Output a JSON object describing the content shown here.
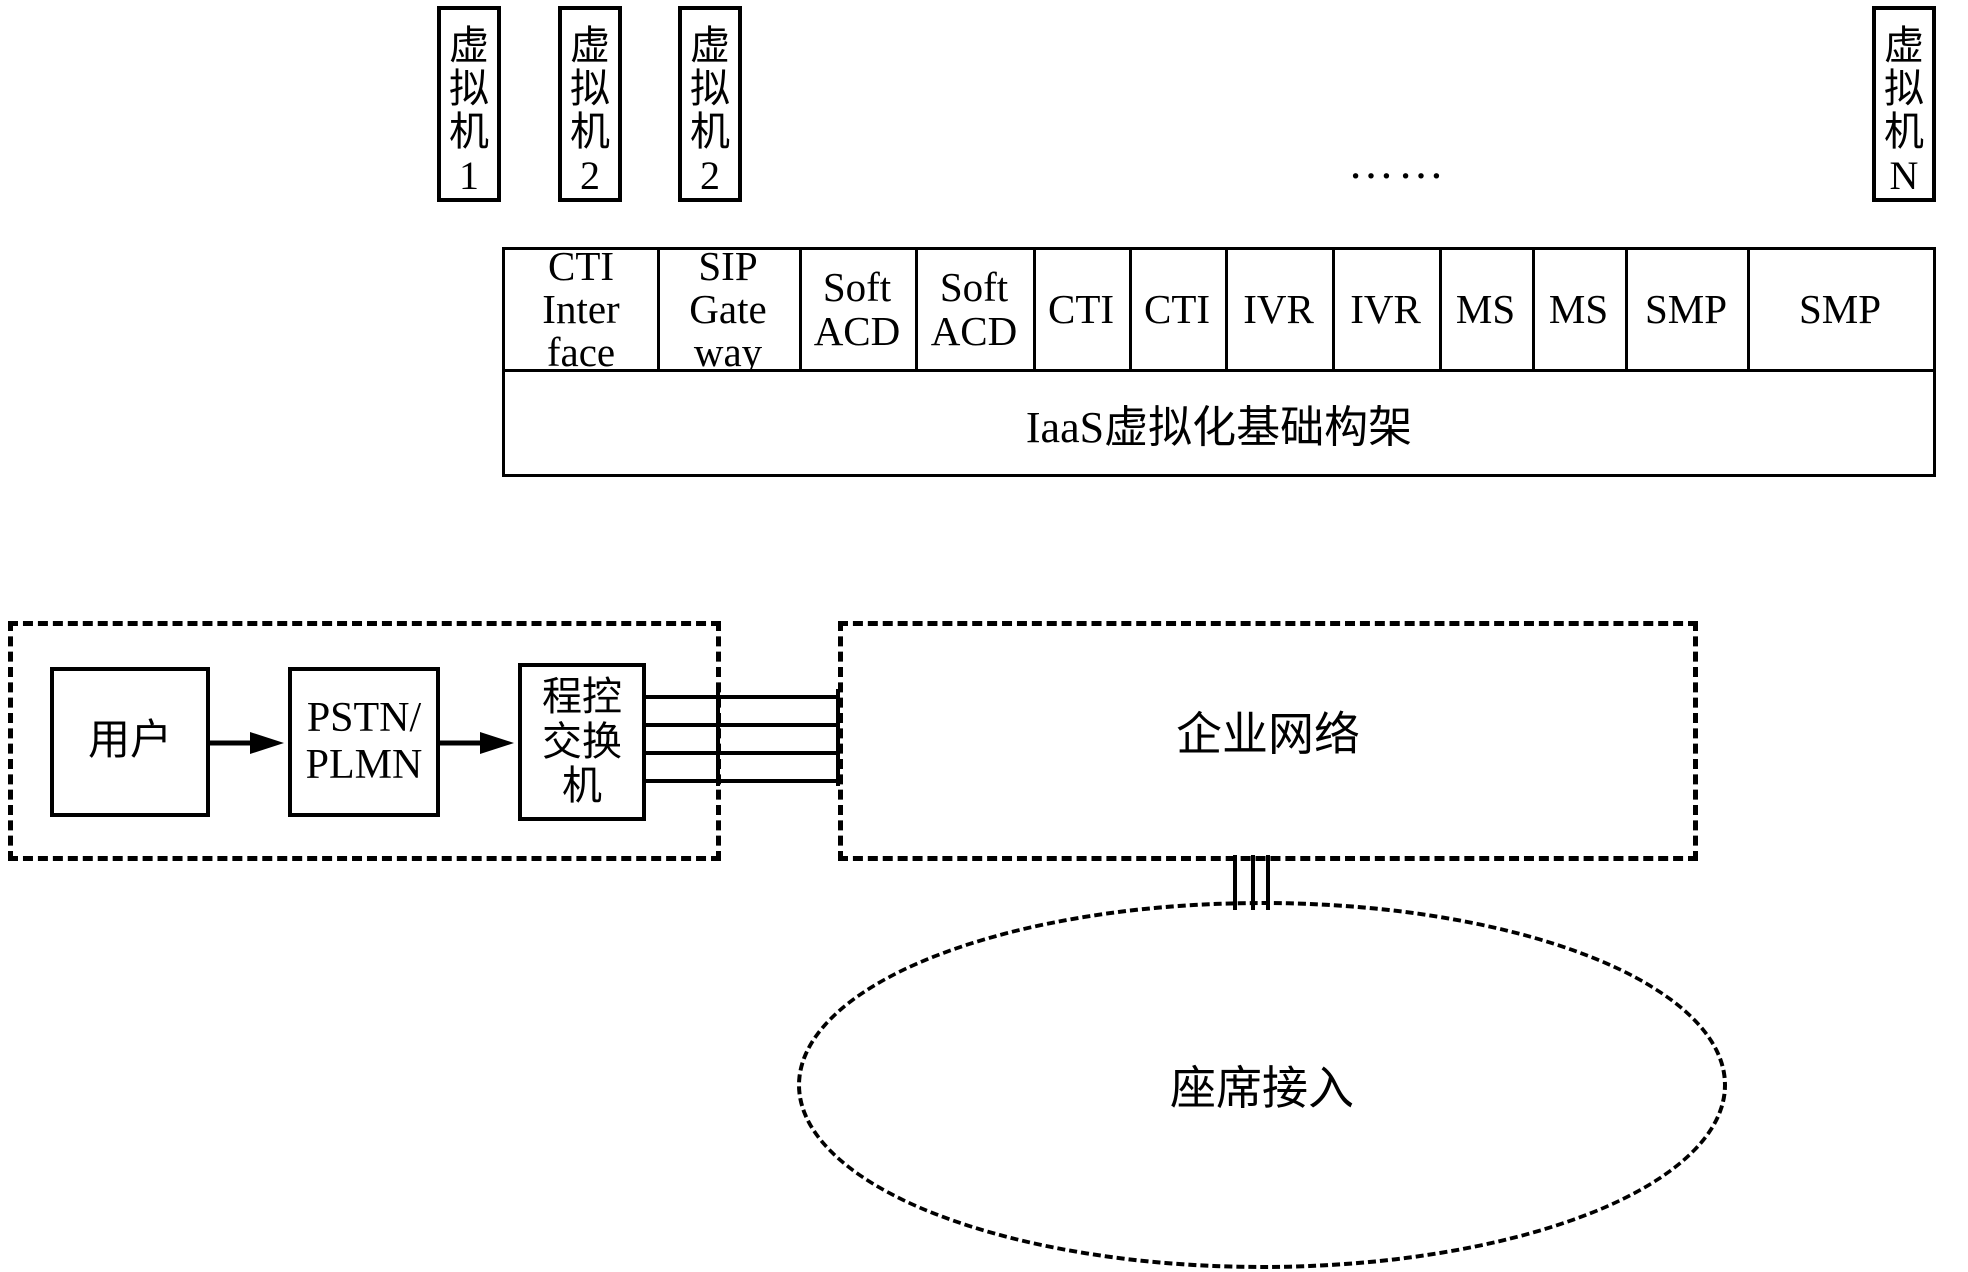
{
  "diagram": {
    "title": "IaaS virtualized call center architecture",
    "colors": {
      "stroke": "#000000",
      "background": "#ffffff"
    },
    "ellipsis": "……"
  },
  "vms": [
    {
      "name": "vm-1",
      "label_top": "虚拟机",
      "label_num": "1"
    },
    {
      "name": "vm-2",
      "label_top": "虚拟机",
      "label_num": "2"
    },
    {
      "name": "vm-3",
      "label_top": "虚拟机",
      "label_num": "2"
    },
    {
      "name": "vm-n",
      "label_top": "虚拟机",
      "label_num": "N"
    }
  ],
  "services": [
    {
      "name": "cti-interface",
      "line1": "CTI",
      "line2": "Inter",
      "line3": "face"
    },
    {
      "name": "sip-gateway",
      "line1": "SIP",
      "line2": "Gate",
      "line3": "way"
    },
    {
      "name": "soft-acd-1",
      "line1": "Soft",
      "line2": "ACD",
      "line3": ""
    },
    {
      "name": "soft-acd-2",
      "line1": "Soft",
      "line2": "ACD",
      "line3": ""
    },
    {
      "name": "cti-1",
      "line1": "CTI",
      "line2": "",
      "line3": ""
    },
    {
      "name": "cti-2",
      "line1": "CTI",
      "line2": "",
      "line3": ""
    },
    {
      "name": "ivr-1",
      "line1": "IVR",
      "line2": "",
      "line3": ""
    },
    {
      "name": "ivr-2",
      "line1": "IVR",
      "line2": "",
      "line3": ""
    },
    {
      "name": "ms-1",
      "line1": "MS",
      "line2": "",
      "line3": ""
    },
    {
      "name": "ms-2",
      "line1": "MS",
      "line2": "",
      "line3": ""
    },
    {
      "name": "smp-1",
      "line1": "SMP",
      "line2": "",
      "line3": ""
    },
    {
      "name": "smp-2",
      "line1": "SMP",
      "line2": "",
      "line3": ""
    }
  ],
  "iaas": {
    "label": "IaaS虚拟化基础构架"
  },
  "telecom": {
    "user": {
      "label": "用户"
    },
    "pstn": {
      "line1": "PSTN/",
      "line2": "PLMN"
    },
    "pbx": {
      "line1": "程控",
      "line2": "交换",
      "line3": "机"
    }
  },
  "enterprise_network": {
    "label": "企业网络"
  },
  "agent_access": {
    "label": "座席接入"
  }
}
